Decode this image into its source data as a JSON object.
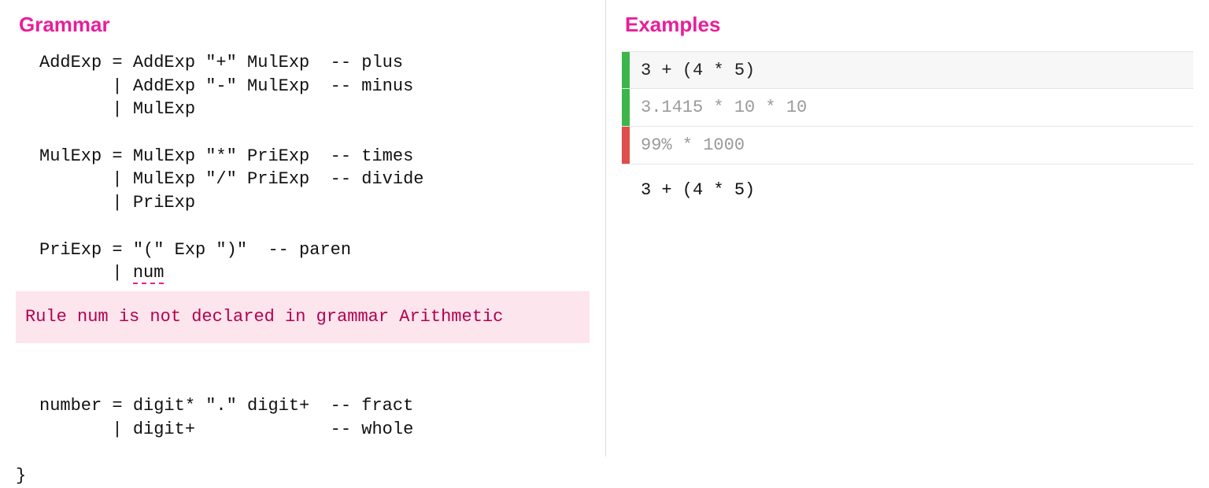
{
  "grammar": {
    "title": "Grammar",
    "lines_before": "AddExp = AddExp \"+\" MulExp  -- plus\n       | AddExp \"-\" MulExp  -- minus\n       | MulExp\n\nMulExp = MulExp \"*\" PriExp  -- times\n       | MulExp \"/\" PriExp  -- divide\n       | PriExp\n\nPriExp = \"(\" Exp \")\"  -- paren\n       | ",
    "error_token": "num",
    "error_message": "Rule num is not declared in grammar Arithmetic",
    "lines_after": "\n\nnumber = digit* \".\" digit+  -- fract\n       | digit+             -- whole\n",
    "closing_brace": "}"
  },
  "examples": {
    "title": "Examples",
    "items": [
      {
        "text": "3 + (4 * 5)",
        "status": "pass",
        "selected": true
      },
      {
        "text": "3.1415 * 10 * 10",
        "status": "pass",
        "selected": false
      },
      {
        "text": "99% * 1000",
        "status": "fail",
        "selected": false
      }
    ],
    "detail": "3 + (4 * 5)"
  }
}
